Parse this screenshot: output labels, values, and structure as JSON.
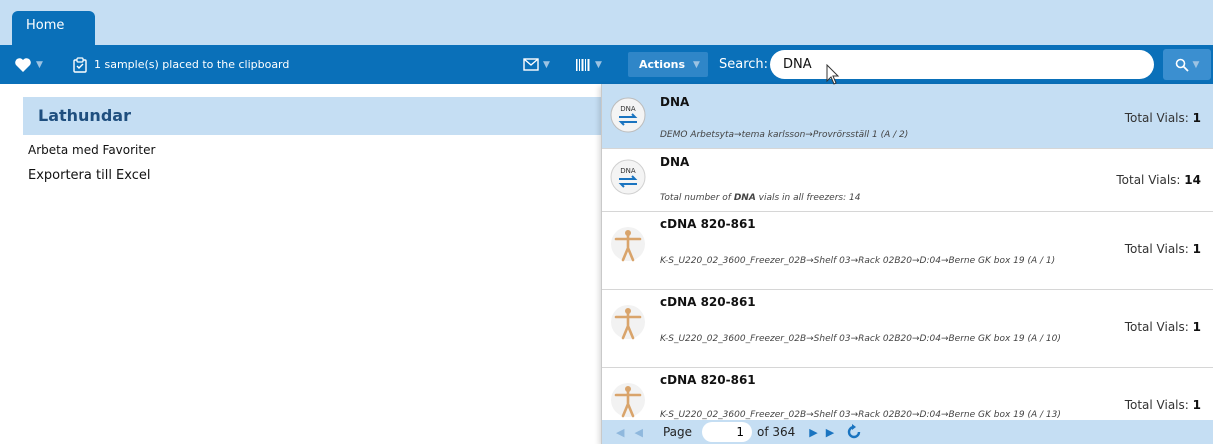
{
  "tabs": [
    {
      "label": "Home"
    }
  ],
  "toolbar": {
    "clipboard_text": "1 sample(s) placed to the clipboard",
    "actions_label": "Actions",
    "search_label": "Search:",
    "search_value": "DNA"
  },
  "left_panel": {
    "header": "Lathundar",
    "links": [
      "Arbeta med Favoriter",
      "Exportera till Excel"
    ]
  },
  "results": [
    {
      "title": "DNA",
      "subtitle": "DEMO Arbetsyta→tema karlsson→Provrörsställ 1 (A / 2)",
      "vials_label": "Total Vials:",
      "vials": "1",
      "icon": "dna-icon",
      "selected": true
    },
    {
      "title": "DNA",
      "subtitle_pre": "Total number of ",
      "subtitle_bold": "DNA",
      "subtitle_post": " vials in all freezers: 14",
      "vials_label": "Total Vials:",
      "vials": "14",
      "icon": "dna-icon"
    },
    {
      "title": "cDNA 820-861",
      "subtitle": "K-S_U220_02_3600_Freezer_02B→Shelf 03→Rack 02B20→D:04→Berne GK box 19 (A / 1)",
      "vials_label": "Total Vials:",
      "vials": "1",
      "icon": "human-body-icon"
    },
    {
      "title": "cDNA 820-861",
      "subtitle": "K-S_U220_02_3600_Freezer_02B→Shelf 03→Rack 02B20→D:04→Berne GK box 19 (A / 10)",
      "vials_label": "Total Vials:",
      "vials": "1",
      "icon": "human-body-icon"
    },
    {
      "title": "cDNA 820-861",
      "subtitle": "K-S_U220_02_3600_Freezer_02B→Shelf 03→Rack 02B20→D:04→Berne GK box 19 (A / 13)",
      "vials_label": "Total Vials:",
      "vials": "1",
      "icon": "human-body-icon"
    }
  ],
  "pager": {
    "page_label": "Page",
    "page": "1",
    "of_label": "of 364"
  },
  "colors": {
    "primary": "#0a70b9",
    "light": "#c5def3"
  }
}
